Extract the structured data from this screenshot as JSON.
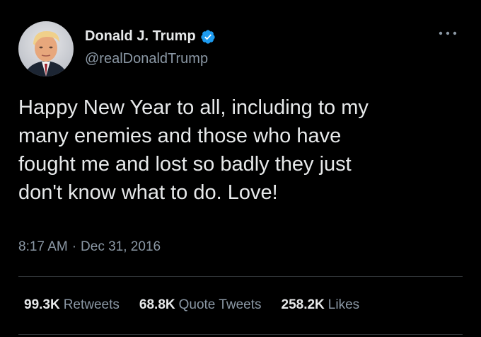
{
  "author": {
    "display_name": "Donald J. Trump",
    "handle": "@realDonaldTrump",
    "verified_icon": "verified-badge-icon"
  },
  "tweet": {
    "text": "Happy New Year to all, including to my\nmany enemies and those who have\nfought me and lost so badly they just\ndon't know what to do. Love!",
    "time": "8:17 AM",
    "separator": "·",
    "date": "Dec 31, 2016"
  },
  "stats": {
    "retweets_count": "99.3K",
    "retweets_label": "Retweets",
    "quotes_count": "68.8K",
    "quotes_label": "Quote Tweets",
    "likes_count": "258.2K",
    "likes_label": "Likes"
  },
  "colors": {
    "background": "#000000",
    "text_primary": "#e7e9ea",
    "text_secondary": "#8b98a5",
    "verified_blue": "#1d9bf0",
    "divider": "#2f3336"
  }
}
